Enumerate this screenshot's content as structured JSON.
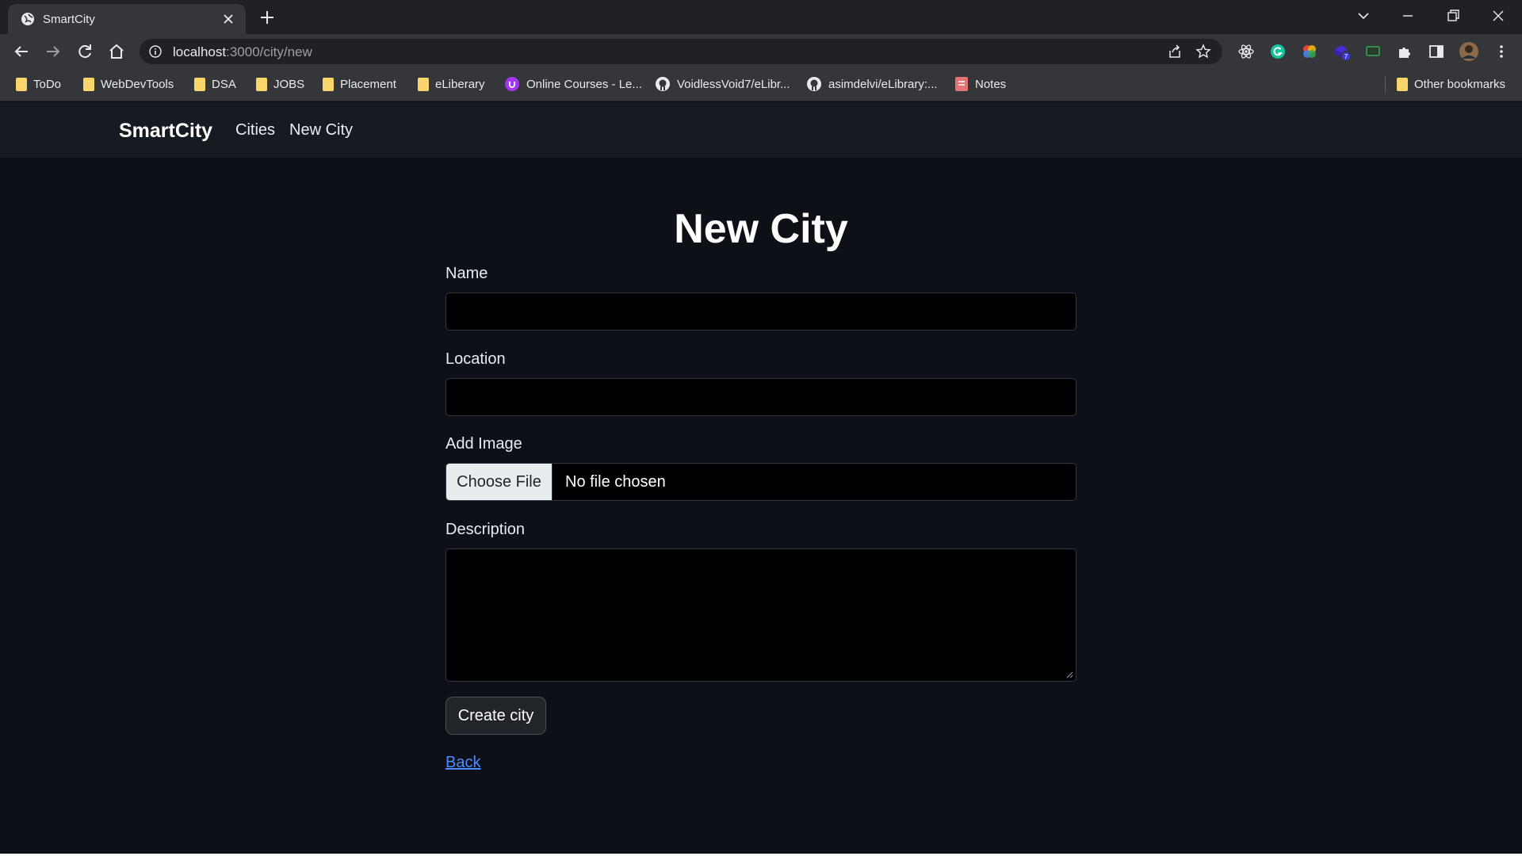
{
  "browser": {
    "tab_title": "SmartCity",
    "url_host": "localhost",
    "url_path": ":3000/city/new",
    "bookmarks": [
      {
        "label": "ToDo",
        "icon": "folder-icon"
      },
      {
        "label": "WebDevTools",
        "icon": "folder-icon"
      },
      {
        "label": "DSA",
        "icon": "folder-icon"
      },
      {
        "label": "JOBS",
        "icon": "folder-icon"
      },
      {
        "label": "Placement",
        "icon": "folder-icon"
      },
      {
        "label": "eLiberary",
        "icon": "folder-icon"
      },
      {
        "label": "Online Courses - Le...",
        "icon": "udemy-icon"
      },
      {
        "label": "VoidlessVoid7/eLibr...",
        "icon": "github-icon"
      },
      {
        "label": "asimdelvi/eLibrary:...",
        "icon": "github-icon"
      },
      {
        "label": "Notes",
        "icon": "notes-icon"
      }
    ],
    "other_bookmarks": "Other bookmarks",
    "extension_badge": "7",
    "colors": {
      "tab_strip": "#202124",
      "toolbar": "#35363a",
      "folder": "#f9d56b"
    }
  },
  "navbar": {
    "brand": "SmartCity",
    "links": [
      "Cities",
      "New City"
    ]
  },
  "form": {
    "heading": "New City",
    "name_label": "Name",
    "name_value": "",
    "location_label": "Location",
    "location_value": "",
    "image_label": "Add Image",
    "choose_file": "Choose File",
    "no_file": "No file chosen",
    "description_label": "Description",
    "description_value": "",
    "submit": "Create city",
    "back": "Back"
  },
  "colors": {
    "page_bg": "#0d1117",
    "navbar_bg": "#161b22",
    "input_bg": "#000000",
    "link": "#4a8cff"
  }
}
